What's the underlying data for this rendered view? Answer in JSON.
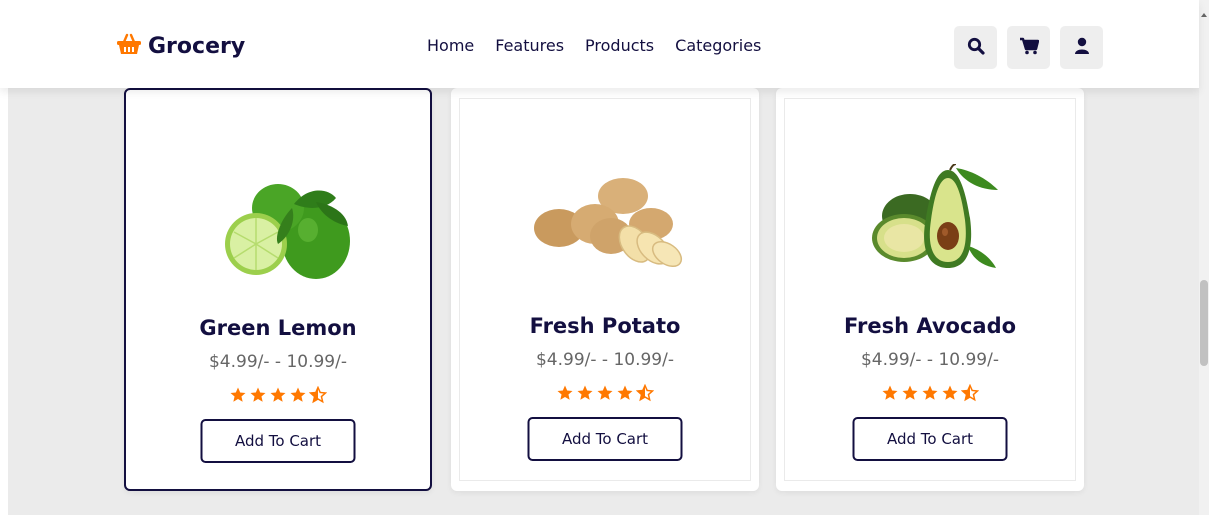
{
  "brand": {
    "name": "Grocery",
    "accent": "#ff7800",
    "dark": "#130f40"
  },
  "nav": [
    {
      "label": "Home"
    },
    {
      "label": "Features"
    },
    {
      "label": "Products"
    },
    {
      "label": "Categories"
    }
  ],
  "header_icons": [
    "search-icon",
    "cart-icon",
    "user-icon"
  ],
  "products": [
    {
      "name": "Green Lemon",
      "price": "$4.99/- - 10.99/-",
      "rating": 4.5,
      "button": "Add To Cart"
    },
    {
      "name": "Fresh Potato",
      "price": "$4.99/- - 10.99/-",
      "rating": 4.5,
      "button": "Add To Cart"
    },
    {
      "name": "Fresh Avocado",
      "price": "$4.99/- - 10.99/-",
      "rating": 4.5,
      "button": "Add To Cart"
    }
  ]
}
